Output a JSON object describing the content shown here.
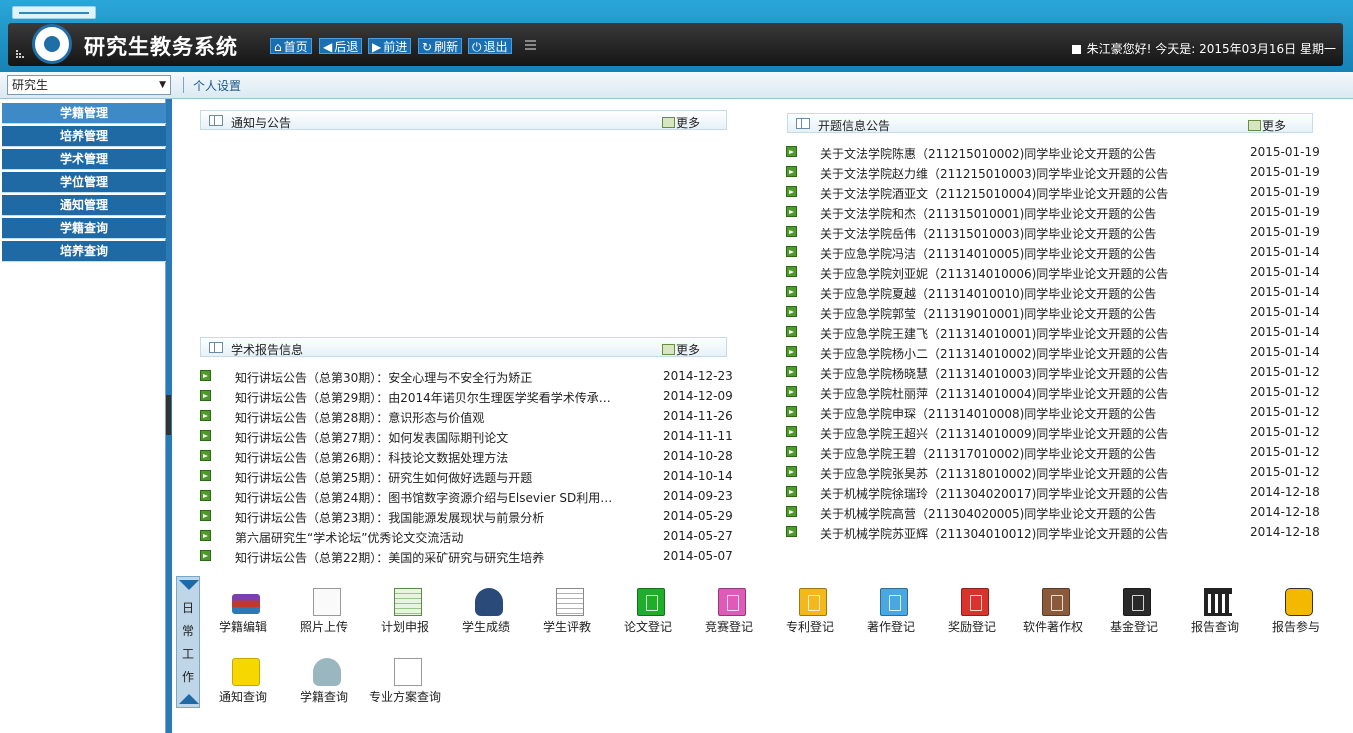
{
  "header": {
    "system_title": "研究生教务系统",
    "nav": [
      {
        "label": "首页",
        "icon": "home-icon"
      },
      {
        "label": "后退",
        "icon": "back-arrow-icon"
      },
      {
        "label": "前进",
        "icon": "forward-arrow-icon"
      },
      {
        "label": "刷新",
        "icon": "refresh-icon"
      },
      {
        "label": "退出",
        "icon": "power-icon"
      }
    ],
    "welcome": "朱江豪您好! 今天是: 2015年03月16日 星期一"
  },
  "toolbar": {
    "role_selected": "研究生",
    "personal_settings": "个人设置"
  },
  "sidebar": {
    "items": [
      {
        "label": "学籍管理"
      },
      {
        "label": "培养管理"
      },
      {
        "label": "学术管理"
      },
      {
        "label": "学位管理"
      },
      {
        "label": "通知管理"
      },
      {
        "label": "学籍查询"
      },
      {
        "label": "培养查询"
      }
    ]
  },
  "panels": {
    "notices": {
      "title": "通知与公告",
      "more": "更多"
    },
    "reports": {
      "title": "学术报告信息",
      "more": "更多",
      "items": [
        {
          "text": "知行讲坛公告（总第30期）：安全心理与不安全行为矫正",
          "date": "2014-12-23"
        },
        {
          "text": "知行讲坛公告（总第29期）：由2014年诺贝尔生理医学奖看学术传承…",
          "date": "2014-12-09"
        },
        {
          "text": "知行讲坛公告（总第28期）：意识形态与价值观",
          "date": "2014-11-26"
        },
        {
          "text": "知行讲坛公告（总第27期）：如何发表国际期刊论文",
          "date": "2014-11-11"
        },
        {
          "text": "知行讲坛公告（总第26期）：科技论文数据处理方法",
          "date": "2014-10-28"
        },
        {
          "text": "知行讲坛公告（总第25期）：研究生如何做好选题与开题",
          "date": "2014-10-14"
        },
        {
          "text": "知行讲坛公告（总第24期）：图书馆数字资源介绍与Elsevier SD利用…",
          "date": "2014-09-23"
        },
        {
          "text": "知行讲坛公告（总第23期）：我国能源发展现状与前景分析",
          "date": "2014-05-29"
        },
        {
          "text": "第六届研究生“学术论坛”优秀论文交流活动",
          "date": "2014-05-27"
        },
        {
          "text": "知行讲坛公告（总第22期）：美国的采矿研究与研究生培养",
          "date": "2014-05-07"
        }
      ]
    },
    "proposals": {
      "title": "开题信息公告",
      "more": "更多",
      "items": [
        {
          "text": "关于文法学院陈惠（211215010002)同学毕业论文开题的公告",
          "date": "2015-01-19"
        },
        {
          "text": "关于文法学院赵力维（211215010003)同学毕业论文开题的公告",
          "date": "2015-01-19"
        },
        {
          "text": "关于文法学院酒亚文（211215010004)同学毕业论文开题的公告",
          "date": "2015-01-19"
        },
        {
          "text": "关于文法学院和杰（211315010001)同学毕业论文开题的公告",
          "date": "2015-01-19"
        },
        {
          "text": "关于文法学院岳伟（211315010003)同学毕业论文开题的公告",
          "date": "2015-01-19"
        },
        {
          "text": "关于应急学院冯洁（211314010005)同学毕业论文开题的公告",
          "date": "2015-01-14"
        },
        {
          "text": "关于应急学院刘亚妮（211314010006)同学毕业论文开题的公告",
          "date": "2015-01-14"
        },
        {
          "text": "关于应急学院夏越（211314010010)同学毕业论文开题的公告",
          "date": "2015-01-14"
        },
        {
          "text": "关于应急学院郭莹（211319010001)同学毕业论文开题的公告",
          "date": "2015-01-14"
        },
        {
          "text": "关于应急学院王建飞（211314010001)同学毕业论文开题的公告",
          "date": "2015-01-14"
        },
        {
          "text": "关于应急学院杨小二（211314010002)同学毕业论文开题的公告",
          "date": "2015-01-14"
        },
        {
          "text": "关于应急学院杨晓慧（211314010003)同学毕业论文开题的公告",
          "date": "2015-01-12"
        },
        {
          "text": "关于应急学院杜丽萍（211314010004)同学毕业论文开题的公告",
          "date": "2015-01-12"
        },
        {
          "text": "关于应急学院申琛（211314010008)同学毕业论文开题的公告",
          "date": "2015-01-12"
        },
        {
          "text": "关于应急学院王超兴（211314010009)同学毕业论文开题的公告",
          "date": "2015-01-12"
        },
        {
          "text": "关于应急学院王碧（211317010002)同学毕业论文开题的公告",
          "date": "2015-01-12"
        },
        {
          "text": "关于应急学院张昊苏（211318010002)同学毕业论文开题的公告",
          "date": "2015-01-12"
        },
        {
          "text": "关于机械学院徐瑞玲（211304020017)同学毕业论文开题的公告",
          "date": "2014-12-18"
        },
        {
          "text": "关于机械学院高营（211304020005)同学毕业论文开题的公告",
          "date": "2014-12-18"
        },
        {
          "text": "关于机械学院苏亚辉（211304010012)同学毕业论文开题的公告",
          "date": "2014-12-18"
        }
      ]
    }
  },
  "daily_work": {
    "tab_label": [
      "日",
      "常",
      "工",
      "作"
    ],
    "apps": [
      {
        "label": "学籍编辑",
        "icon": "books-icon"
      },
      {
        "label": "照片上传",
        "icon": "photo-placeholder-icon"
      },
      {
        "label": "计划申报",
        "icon": "spreadsheet-icon"
      },
      {
        "label": "学生成绩",
        "icon": "user-icon"
      },
      {
        "label": "学生评教",
        "icon": "document-edit-icon"
      },
      {
        "label": "论文登记",
        "icon": "green-book-icon",
        "color": "#1fae2a"
      },
      {
        "label": "竞赛登记",
        "icon": "pink-book-icon",
        "color": "#e05ab8"
      },
      {
        "label": "专利登记",
        "icon": "yellow-book-icon",
        "color": "#f2b81c"
      },
      {
        "label": "著作登记",
        "icon": "blue-book-icon",
        "color": "#4aa8e0"
      },
      {
        "label": "奖励登记",
        "icon": "red-book-icon",
        "color": "#d9332b"
      },
      {
        "label": "软件著作权",
        "icon": "brown-book-icon",
        "color": "#8a5a3a"
      },
      {
        "label": "基金登记",
        "icon": "black-book-icon",
        "color": "#2a2a2a"
      },
      {
        "label": "报告查询",
        "icon": "building-icon"
      },
      {
        "label": "报告参与",
        "icon": "walking-person-icon"
      },
      {
        "label": "通知查询",
        "icon": "folder-icon"
      },
      {
        "label": "学籍查询",
        "icon": "robot-user-icon"
      },
      {
        "label": "专业方案查询",
        "icon": "function-icon"
      }
    ]
  }
}
